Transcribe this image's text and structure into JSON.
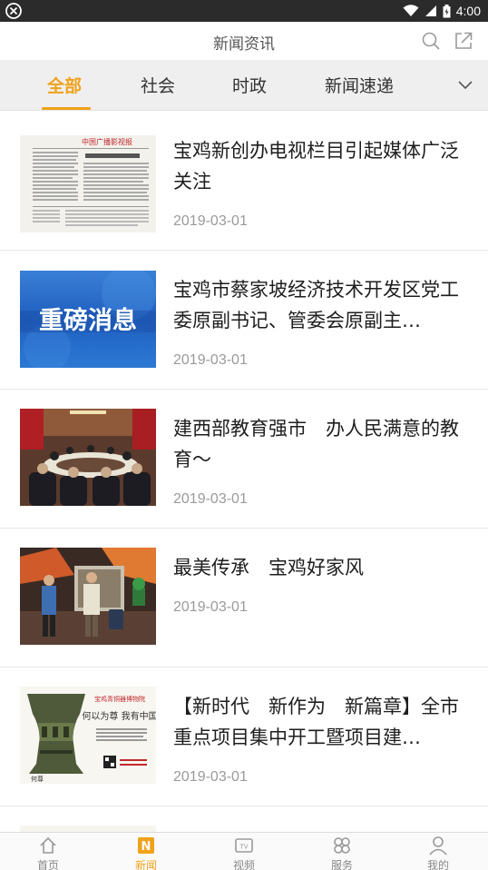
{
  "status_bar": {
    "time": "4:00"
  },
  "header": {
    "title": "新闻资讯"
  },
  "tabs": [
    {
      "label": "全部",
      "active": true
    },
    {
      "label": "社会",
      "active": false
    },
    {
      "label": "时政",
      "active": false
    },
    {
      "label": "新闻速递",
      "active": false
    }
  ],
  "news": [
    {
      "title": "宝鸡新创办电视栏目引起媒体广泛关注",
      "date": "2019-03-01",
      "thumb": "newspaper-page-image",
      "thumb_text": "中国广播影视报"
    },
    {
      "title": "宝鸡市蔡家坡经济技术开发区党工委原副书记、管委会原副主…",
      "date": "2019-03-01",
      "thumb": "breaking-news-banner-image",
      "thumb_text": "重磅消息"
    },
    {
      "title": "建西部教育强市　办人民满意的教育～",
      "date": "2019-03-01",
      "thumb": "conference-meeting-photo"
    },
    {
      "title": "最美传承　宝鸡好家风",
      "date": "2019-03-01",
      "thumb": "tv-studio-stage-photo"
    },
    {
      "title": "【新时代　新作为　新篇章】全市重点项目集中开工暨项目建…",
      "date": "2019-03-01",
      "thumb": "bronze-vessel-poster-image",
      "thumb_text": "何以为尊 我有中国"
    }
  ],
  "bottom_nav": [
    {
      "label": "首页",
      "icon": "home-icon",
      "active": false
    },
    {
      "label": "新闻",
      "icon": "news-icon",
      "active": true
    },
    {
      "label": "视频",
      "icon": "tv-icon",
      "active": false
    },
    {
      "label": "服务",
      "icon": "services-icon",
      "active": false
    },
    {
      "label": "我的",
      "icon": "profile-icon",
      "active": false
    }
  ],
  "colors": {
    "accent": "#f0a21b",
    "status_bar": "#2b2b2b",
    "tab_bar": "#efefef"
  }
}
